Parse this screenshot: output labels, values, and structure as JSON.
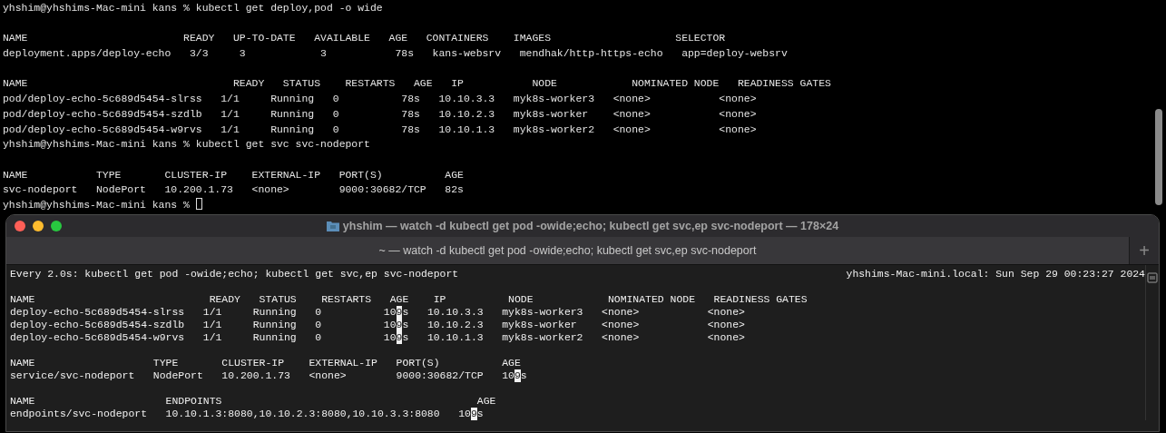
{
  "back_terminal": {
    "blocks": [
      [
        {
          "text": "yhshim@yhshims-Mac-mini kans % kubectl get deploy,pod -o wide"
        }
      ],
      [
        {
          "text": "NAME                         READY   UP-TO-DATE   AVAILABLE   AGE   CONTAINERS    IMAGES                    SELECTOR"
        },
        {
          "text": "deployment.apps/deploy-echo   3/3     3            3           78s   kans-websrv   mendhak/http-https-echo   app=deploy-websrv"
        }
      ],
      [
        {
          "text": "NAME                                 READY   STATUS    RESTARTS   AGE   IP           NODE            NOMINATED NODE   READINESS GATES"
        },
        {
          "text": "pod/deploy-echo-5c689d5454-slrss   1/1     Running   0          78s   10.10.3.3   myk8s-worker3   <none>           <none>"
        },
        {
          "text": "pod/deploy-echo-5c689d5454-szdlb   1/1     Running   0          78s   10.10.2.3   myk8s-worker    <none>           <none>"
        },
        {
          "text": "pod/deploy-echo-5c689d5454-w9rvs   1/1     Running   0          78s   10.10.1.3   myk8s-worker2   <none>           <none>"
        },
        {
          "text": "yhshim@yhshims-Mac-mini kans % kubectl get svc svc-nodeport"
        }
      ],
      [
        {
          "text": "NAME           TYPE       CLUSTER-IP    EXTERNAL-IP   PORT(S)          AGE"
        },
        {
          "text": "svc-nodeport   NodePort   10.200.1.73   <none>        9000:30682/TCP   82s"
        },
        {
          "text": "yhshim@yhshims-Mac-mini kans % ",
          "cursor": true
        }
      ]
    ]
  },
  "window": {
    "title": "yhshim — watch -d kubectl get pod -owide;echo; kubectl get svc,ep svc-nodeport — 178×24",
    "tabs": [
      {
        "label": "~ — watch -d kubectl get pod -owide;echo; kubectl get svc,ep svc-nodeport",
        "selected": true
      }
    ],
    "new_tab": "+",
    "watch_header": {
      "command": "Every 2.0s: kubectl get pod -owide;echo; kubectl get svc,ep svc-nodeport",
      "host_time": "yhshims-Mac-mini.local: Sun Sep 29 00:23:27 2024"
    },
    "blocks": [
      [
        {
          "segments": [
            {
              "text": "NAME                            READY   STATUS    RESTARTS   AGE    IP          NODE            NOMINATED NODE   READINESS GATES",
              "highlighted": false
            }
          ]
        },
        {
          "segments": [
            {
              "text": "deploy-echo-5c689d5454-slrss   1/1     Running   0          10",
              "highlighted": false
            },
            {
              "text": "9",
              "highlighted": true
            },
            {
              "text": "s   10.10.3.3   myk8s-worker3   <none>           <none>",
              "highlighted": false
            }
          ]
        },
        {
          "segments": [
            {
              "text": "deploy-echo-5c689d5454-szdlb   1/1     Running   0          10",
              "highlighted": false
            },
            {
              "text": "9",
              "highlighted": true
            },
            {
              "text": "s   10.10.2.3   myk8s-worker    <none>           <none>",
              "highlighted": false
            }
          ]
        },
        {
          "segments": [
            {
              "text": "deploy-echo-5c689d5454-w9rvs   1/1     Running   0          10",
              "highlighted": false
            },
            {
              "text": "9",
              "highlighted": true
            },
            {
              "text": "s   10.10.1.3   myk8s-worker2   <none>           <none>",
              "highlighted": false
            }
          ]
        }
      ],
      [
        {
          "segments": [
            {
              "text": "NAME                   TYPE       CLUSTER-IP    EXTERNAL-IP   PORT(S)          AGE",
              "highlighted": false
            }
          ]
        },
        {
          "segments": [
            {
              "text": "service/svc-nodeport   NodePort   10.200.1.73   <none>        9000:30682/TCP   10",
              "highlighted": false
            },
            {
              "text": "9",
              "highlighted": true
            },
            {
              "text": "s",
              "highlighted": false
            }
          ]
        }
      ],
      [
        {
          "segments": [
            {
              "text": "NAME                     ENDPOINTS                                         AGE",
              "highlighted": false
            }
          ]
        },
        {
          "segments": [
            {
              "text": "endpoints/svc-nodeport   10.10.1.3:8080,10.10.2.3:8080,10.10.3.3:8080   10",
              "highlighted": false
            },
            {
              "text": "9",
              "highlighted": true
            },
            {
              "text": "s",
              "highlighted": false
            }
          ]
        }
      ]
    ]
  }
}
